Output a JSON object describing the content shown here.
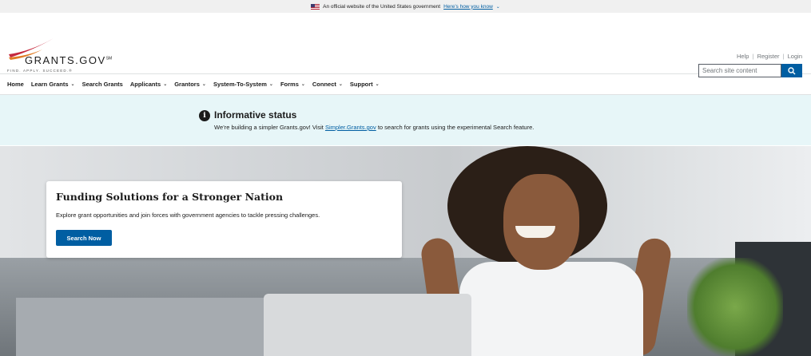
{
  "gov_banner": {
    "text": "An official website of the United States government",
    "link": "Here’s how you know",
    "chevron": "⌄"
  },
  "logo": {
    "wordmark": "GRANTS.GOV",
    "trademark": "SM",
    "tagline": "FIND. APPLY. SUCCEED.®"
  },
  "utility_links": {
    "help": "Help",
    "register": "Register",
    "login": "Login",
    "separator": "|"
  },
  "search": {
    "placeholder": "Search site content"
  },
  "nav": {
    "items": [
      {
        "label": "Home",
        "has_menu": false
      },
      {
        "label": "Learn Grants",
        "has_menu": true
      },
      {
        "label": "Search Grants",
        "has_menu": false
      },
      {
        "label": "Applicants",
        "has_menu": true
      },
      {
        "label": "Grantors",
        "has_menu": true
      },
      {
        "label": "System-To-System",
        "has_menu": true
      },
      {
        "label": "Forms",
        "has_menu": true
      },
      {
        "label": "Connect",
        "has_menu": true
      },
      {
        "label": "Support",
        "has_menu": true
      }
    ],
    "caret": "⌄"
  },
  "alert": {
    "title": "Informative status",
    "body_prefix": "We’re building a simpler Grants.gov! Visit ",
    "link": "Simpler.Grants.gov",
    "body_suffix": " to search for grants using the experimental Search feature."
  },
  "hero": {
    "title": "Funding Solutions for a Stronger Nation",
    "description": "Explore grant opportunities and join forces with government agencies to tackle pressing challenges.",
    "button": "Search Now"
  },
  "colors": {
    "primary": "#005ea2",
    "alert_bg": "#e7f6f8",
    "logo_red": "#c5283d",
    "logo_orange": "#e07b24"
  }
}
